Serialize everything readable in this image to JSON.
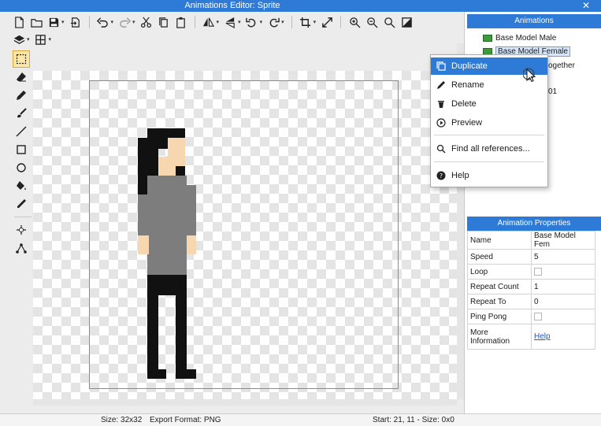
{
  "window": {
    "title": "Animations Editor: Sprite",
    "close_glyph": "✕"
  },
  "toolbar": {
    "row1": [
      "new-file-icon",
      "open-folder-icon",
      "save-icon",
      "export-icon",
      "undo-icon",
      "redo-icon",
      "cut-icon",
      "copy-icon",
      "paste-icon",
      "flip-horizontal-icon",
      "flip-vertical-icon",
      "rotate-left-icon",
      "rotate-right-icon",
      "crop-icon",
      "resize-icon",
      "zoom-in-icon",
      "zoom-out-icon",
      "zoom-reset-icon",
      "fit-icon"
    ],
    "row2": [
      "layers-icon",
      "grid-icon"
    ]
  },
  "tools": [
    "select-icon",
    "eraser-icon",
    "pencil-icon",
    "brush-icon",
    "line-icon",
    "rectangle-icon",
    "ellipse-icon",
    "fill-icon",
    "color-picker-icon",
    "pivot-icon",
    "points-icon"
  ],
  "animations_panel": {
    "title": "Animations",
    "items": [
      {
        "label": "Base Model Male",
        "selected": false
      },
      {
        "label": "Base Model Female",
        "selected": true
      },
      {
        "label": "ogether",
        "selected": false
      },
      {
        "label": "01",
        "selected": false
      }
    ]
  },
  "context_menu": {
    "items": [
      {
        "label": "Duplicate",
        "icon": "duplicate-icon"
      },
      {
        "label": "Rename",
        "icon": "rename-icon"
      },
      {
        "label": "Delete",
        "icon": "delete-icon"
      },
      {
        "label": "Preview",
        "icon": "preview-icon"
      },
      {
        "label": "Find all references...",
        "icon": "search-icon"
      },
      {
        "label": "Help",
        "icon": "help-icon"
      }
    ]
  },
  "properties": {
    "title": "Animation Properties",
    "rows": [
      {
        "key": "Name",
        "value": "Base Model Fem"
      },
      {
        "key": "Speed",
        "value": "5"
      },
      {
        "key": "Loop",
        "value": ""
      },
      {
        "key": "Repeat Count",
        "value": "1"
      },
      {
        "key": "Repeat To",
        "value": "0"
      },
      {
        "key": "Ping Pong",
        "value": ""
      },
      {
        "key": "More Information",
        "value": "Help"
      }
    ]
  },
  "status": {
    "size": "Size: 32x32",
    "format": "Export Format: PNG",
    "selection": "Start: 21, 11 - Size: 0x0"
  },
  "colors": {
    "accent": "#2d7bd6",
    "hair": "#111111",
    "skin": "#f6d7b0",
    "shirt": "#7d7d7d",
    "pants": "#111111",
    "swatch": "#3e9a3a"
  }
}
